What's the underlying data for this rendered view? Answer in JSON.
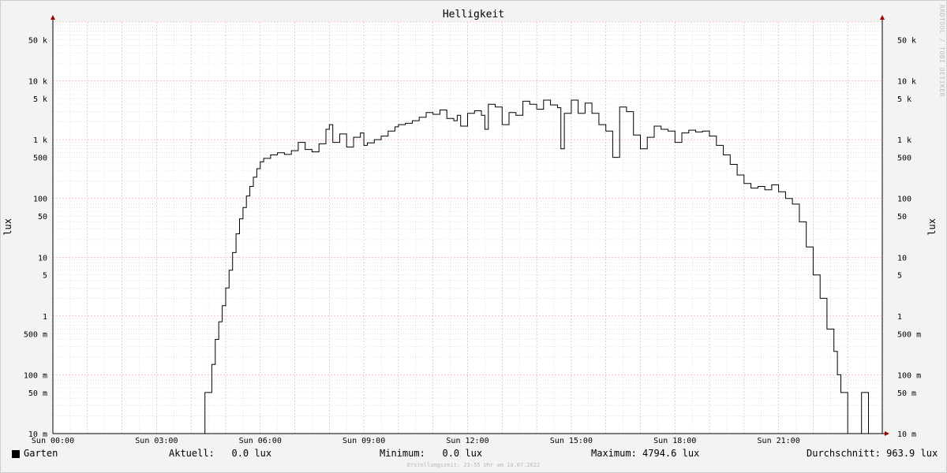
{
  "chart_data": {
    "type": "line",
    "title": "Helligkeit",
    "ylabel": "lux",
    "yscale": "log",
    "ylim": [
      0.01,
      100000
    ],
    "y_ticks": [
      {
        "value": 0.01,
        "label": "10 m"
      },
      {
        "value": 0.05,
        "label": "50 m"
      },
      {
        "value": 0.1,
        "label": "100 m"
      },
      {
        "value": 0.5,
        "label": "500 m"
      },
      {
        "value": 1,
        "label": "1"
      },
      {
        "value": 5,
        "label": "5"
      },
      {
        "value": 10,
        "label": "10"
      },
      {
        "value": 50,
        "label": "50"
      },
      {
        "value": 100,
        "label": "100"
      },
      {
        "value": 500,
        "label": "500"
      },
      {
        "value": 1000,
        "label": "1 k"
      },
      {
        "value": 5000,
        "label": "5 k"
      },
      {
        "value": 10000,
        "label": "10 k"
      },
      {
        "value": 50000,
        "label": "50 k"
      }
    ],
    "x_ticks": [
      {
        "hour": 0,
        "label": "Sun 00:00"
      },
      {
        "hour": 3,
        "label": "Sun 03:00"
      },
      {
        "hour": 6,
        "label": "Sun 06:00"
      },
      {
        "hour": 9,
        "label": "Sun 09:00"
      },
      {
        "hour": 12,
        "label": "Sun 12:00"
      },
      {
        "hour": 15,
        "label": "Sun 15:00"
      },
      {
        "hour": 18,
        "label": "Sun 18:00"
      },
      {
        "hour": 21,
        "label": "Sun 21:00"
      }
    ],
    "grid": true,
    "line_color": "#000000",
    "major_grid_color": "#e8a0a8",
    "minor_grid_color": "#d0d0d0",
    "series": [
      {
        "name": "Garten",
        "x_hours": [
          0,
          4.2,
          4.4,
          4.6,
          4.7,
          4.8,
          4.9,
          5.0,
          5.1,
          5.2,
          5.3,
          5.4,
          5.5,
          5.6,
          5.7,
          5.8,
          5.9,
          6.0,
          6.1,
          6.3,
          6.5,
          6.7,
          6.9,
          7.1,
          7.3,
          7.5,
          7.7,
          7.9,
          8.0,
          8.1,
          8.3,
          8.5,
          8.7,
          8.9,
          9.0,
          9.1,
          9.3,
          9.5,
          9.7,
          9.9,
          10.0,
          10.2,
          10.4,
          10.6,
          10.8,
          11.0,
          11.2,
          11.4,
          11.6,
          11.7,
          11.8,
          12.0,
          12.2,
          12.4,
          12.5,
          12.6,
          12.8,
          13.0,
          13.2,
          13.4,
          13.6,
          13.8,
          14.0,
          14.2,
          14.4,
          14.6,
          14.7,
          14.8,
          15.0,
          15.2,
          15.4,
          15.6,
          15.8,
          16.0,
          16.2,
          16.4,
          16.6,
          16.8,
          17.0,
          17.2,
          17.4,
          17.6,
          17.8,
          18.0,
          18.2,
          18.4,
          18.6,
          18.8,
          19.0,
          19.2,
          19.4,
          19.6,
          19.8,
          20.0,
          20.2,
          20.4,
          20.6,
          20.8,
          21.0,
          21.2,
          21.4,
          21.6,
          21.8,
          22.0,
          22.2,
          22.4,
          22.6,
          22.7,
          22.8,
          23.0,
          23.2,
          23.4,
          23.6,
          23.8,
          23.9
        ],
        "y_lux": [
          0.01,
          0.01,
          0.05,
          0.15,
          0.4,
          0.8,
          1.5,
          3,
          6,
          12,
          25,
          45,
          70,
          110,
          160,
          230,
          320,
          420,
          480,
          550,
          600,
          560,
          650,
          900,
          680,
          620,
          850,
          1500,
          1800,
          900,
          1250,
          750,
          1100,
          1300,
          800,
          880,
          1000,
          1150,
          1400,
          1650,
          1800,
          1900,
          2100,
          2400,
          2900,
          2700,
          3200,
          2300,
          2100,
          2600,
          1700,
          2800,
          3100,
          2600,
          1500,
          4000,
          3600,
          1800,
          2900,
          2600,
          4500,
          4000,
          3300,
          4700,
          3900,
          3500,
          700,
          2800,
          4700,
          2800,
          4200,
          2800,
          1800,
          1400,
          500,
          3600,
          3000,
          1200,
          700,
          1100,
          1700,
          1500,
          1400,
          900,
          1300,
          1450,
          1350,
          1400,
          1150,
          800,
          550,
          380,
          250,
          180,
          150,
          160,
          140,
          170,
          130,
          100,
          80,
          40,
          15,
          5,
          2,
          0.6,
          0.25,
          0.1,
          0.05,
          0.01,
          0.01,
          0.05,
          0.01,
          0.01,
          0.01
        ]
      }
    ]
  },
  "legend": {
    "name": "Garten",
    "aktuell": "Aktuell:   0.0 lux",
    "minimum": "Minimum:   0.0 lux",
    "maximum": "Maximum: 4794.6 lux",
    "durchschnitt": "Durchschnitt: 963.9 lux"
  },
  "side_note": "RRDTOOL / TOBI OETIKER",
  "footer": "Erstellungszeit: 23:55 Uhr am 10.07.2022"
}
